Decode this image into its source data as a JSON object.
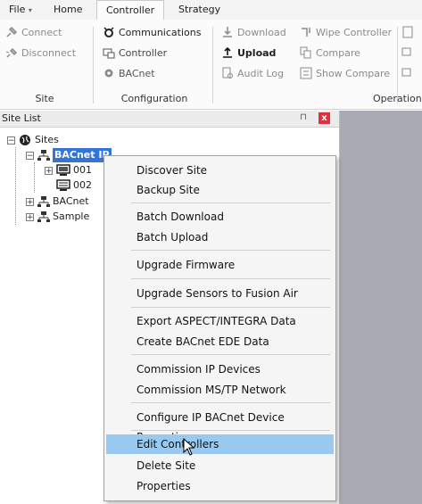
{
  "tabs": {
    "file": "File",
    "file_arrow": "▾",
    "home": "Home",
    "controller": "Controller",
    "strategy": "Strategy"
  },
  "ribbon": {
    "site": {
      "connect": "Connect",
      "disconnect": "Disconnect",
      "label": "Site"
    },
    "configuration": {
      "communications": "Communications",
      "controller": "Controller",
      "bacnet": "BACnet",
      "label": "Configuration"
    },
    "operations": {
      "download": "Download",
      "upload": "Upload",
      "audit_log": "Audit Log",
      "wipe_controller": "Wipe Controller",
      "compare": "Compare",
      "show_compare": "Show Compare",
      "label": "Operation"
    }
  },
  "site_list": {
    "title": "Site List",
    "pin": "⊓",
    "close": "x",
    "nodes": [
      {
        "label": "Sites",
        "expander": "−"
      },
      {
        "label": "BACnet IP",
        "expander": "−"
      },
      {
        "label": "001",
        "expander": "+"
      },
      {
        "label": "002",
        "expander": ""
      },
      {
        "label": "BACnet",
        "expander": "+"
      },
      {
        "label": "Sample",
        "expander": "+"
      }
    ]
  },
  "context_menu": {
    "items": [
      "Discover Site",
      "Backup Site",
      "Batch Download",
      "Batch Upload",
      "Upgrade Firmware",
      "Upgrade Sensors to Fusion Air",
      "Export ASPECT/INTEGRA Data",
      "Create BACnet EDE Data",
      "Commission IP Devices",
      "Commission MS/TP Network",
      "Configure IP BACnet Device Properties",
      "Edit Controllers",
      "Delete Site",
      "Properties"
    ],
    "highlighted": "Edit Controllers"
  },
  "colors": {
    "selection": "#3375d7",
    "menu_highlight": "#99c9ef",
    "close": "#e2303a",
    "workspace": "#a9aab4"
  }
}
